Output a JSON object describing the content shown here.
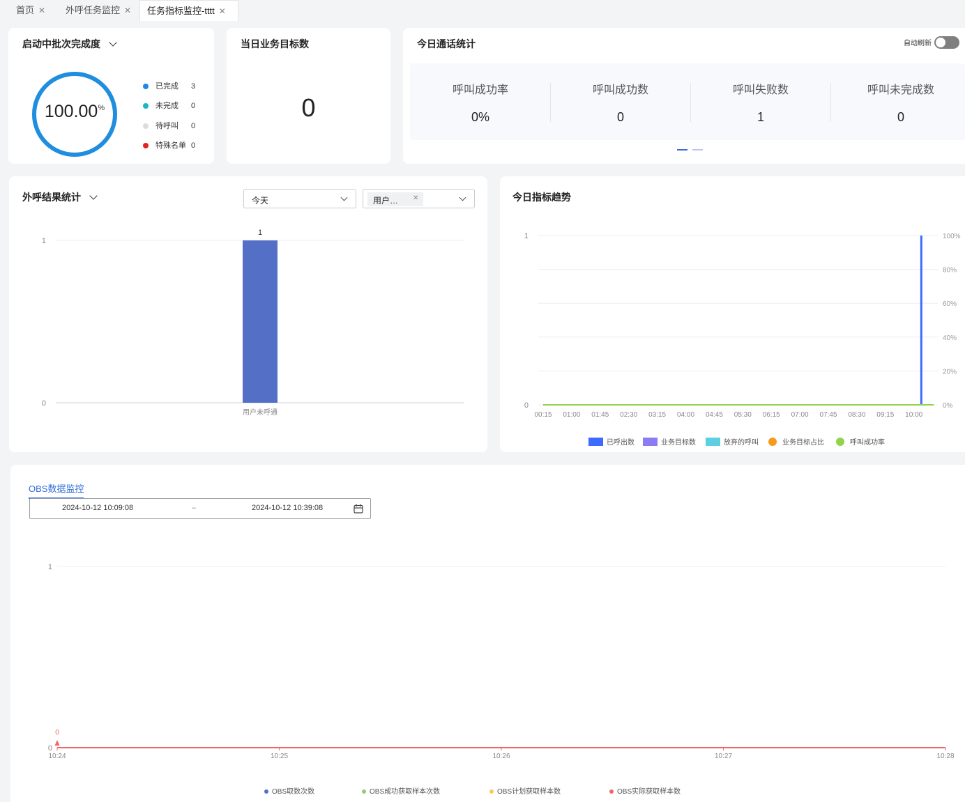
{
  "tabs": [
    {
      "label": "首页"
    },
    {
      "label": "外呼任务监控"
    },
    {
      "label": "任务指标监控-tttt"
    }
  ],
  "completion": {
    "title": "启动中批次完成度",
    "percent_value": "100.00",
    "percent_unit": "%",
    "progress": 1.0,
    "legend": [
      {
        "label": "已完成",
        "value": "3",
        "color": "#1e88e5"
      },
      {
        "label": "未完成",
        "value": "0",
        "color": "#17b7c4"
      },
      {
        "label": "待呼叫",
        "value": "0",
        "color": "#dcdcdc"
      },
      {
        "label": "特殊名单",
        "value": "0",
        "color": "#e32222"
      }
    ]
  },
  "business_target": {
    "title": "当日业务目标数",
    "value": "0"
  },
  "call_stats": {
    "title": "今日通话统计",
    "auto_refresh_label": "自动刷新",
    "auto_refresh_on": false,
    "items": [
      {
        "label": "呼叫成功率",
        "value": "0%"
      },
      {
        "label": "呼叫成功数",
        "value": "0"
      },
      {
        "label": "呼叫失败数",
        "value": "1"
      },
      {
        "label": "呼叫未完成数",
        "value": "0"
      }
    ],
    "page_count": 2,
    "active_page": 0
  },
  "outbound_results": {
    "title": "外呼结果统计",
    "date_select": "今天",
    "tag_select": "用户…"
  },
  "trend": {
    "title": "今日指标趋势"
  },
  "obs": {
    "tab_label": "OBS数据监控",
    "start_time": "2024-10-12 10:09:08",
    "separator": "–",
    "end_time": "2024-10-12 10:39:08"
  },
  "chart_data": [
    {
      "id": "outbound-results",
      "type": "bar",
      "categories": [
        "用户未呼通"
      ],
      "values": [
        1
      ],
      "ylim": [
        0,
        1
      ],
      "yticks": [
        "0",
        "1"
      ],
      "color": "#5470c6",
      "data_labels": [
        "1"
      ]
    },
    {
      "id": "today-trend",
      "type": "line",
      "x": [
        "00:15",
        "01:00",
        "01:45",
        "02:30",
        "03:15",
        "04:00",
        "04:45",
        "05:30",
        "06:15",
        "07:00",
        "07:45",
        "08:30",
        "09:15",
        "10:00"
      ],
      "yticks_left": [
        "0",
        "1"
      ],
      "yticks_right": [
        "0%",
        "20%",
        "40%",
        "60%",
        "80%",
        "100%"
      ],
      "ylim": [
        0,
        1
      ],
      "series": [
        {
          "name": "已呼出数",
          "type": "bar",
          "color": "#3d6bff",
          "values": [
            0,
            0,
            0,
            0,
            0,
            0,
            0,
            0,
            0,
            0,
            0,
            0,
            0,
            1
          ]
        },
        {
          "name": "业务目标数",
          "type": "bar",
          "color": "#8b7cf6",
          "values": [
            0,
            0,
            0,
            0,
            0,
            0,
            0,
            0,
            0,
            0,
            0,
            0,
            0,
            0
          ]
        },
        {
          "name": "放弃的呼叫",
          "type": "bar",
          "color": "#5ccfe0",
          "values": [
            0,
            0,
            0,
            0,
            0,
            0,
            0,
            0,
            0,
            0,
            0,
            0,
            0,
            0
          ]
        },
        {
          "name": "业务目标占比",
          "type": "line",
          "color": "#f59a1c",
          "values": [
            0,
            0,
            0,
            0,
            0,
            0,
            0,
            0,
            0,
            0,
            0,
            0,
            0,
            0
          ]
        },
        {
          "name": "呼叫成功率",
          "type": "line",
          "color": "#8fd44a",
          "values": [
            0,
            0,
            0,
            0,
            0,
            0,
            0,
            0,
            0,
            0,
            0,
            0,
            0,
            0
          ]
        }
      ]
    },
    {
      "id": "obs-monitor",
      "type": "line",
      "x": [
        "10:24",
        "10:25",
        "10:26",
        "10:27",
        "10:28"
      ],
      "ylim": [
        0,
        1
      ],
      "yticks": [
        "0",
        "1"
      ],
      "series": [
        {
          "name": "OBS取数次数",
          "color": "#5470c6",
          "values": [
            0,
            0,
            0,
            0,
            0
          ]
        },
        {
          "name": "OBS成功获取样本次数",
          "color": "#91cc75",
          "values": [
            0,
            0,
            0,
            0,
            0
          ]
        },
        {
          "name": "OBS计划获取样本数",
          "color": "#fac858",
          "values": [
            0,
            0,
            0,
            0,
            0
          ]
        },
        {
          "name": "OBS实际获取样本数",
          "color": "#ee6666",
          "values": [
            0,
            0,
            0,
            0,
            0
          ]
        }
      ],
      "annotation": "0"
    }
  ]
}
